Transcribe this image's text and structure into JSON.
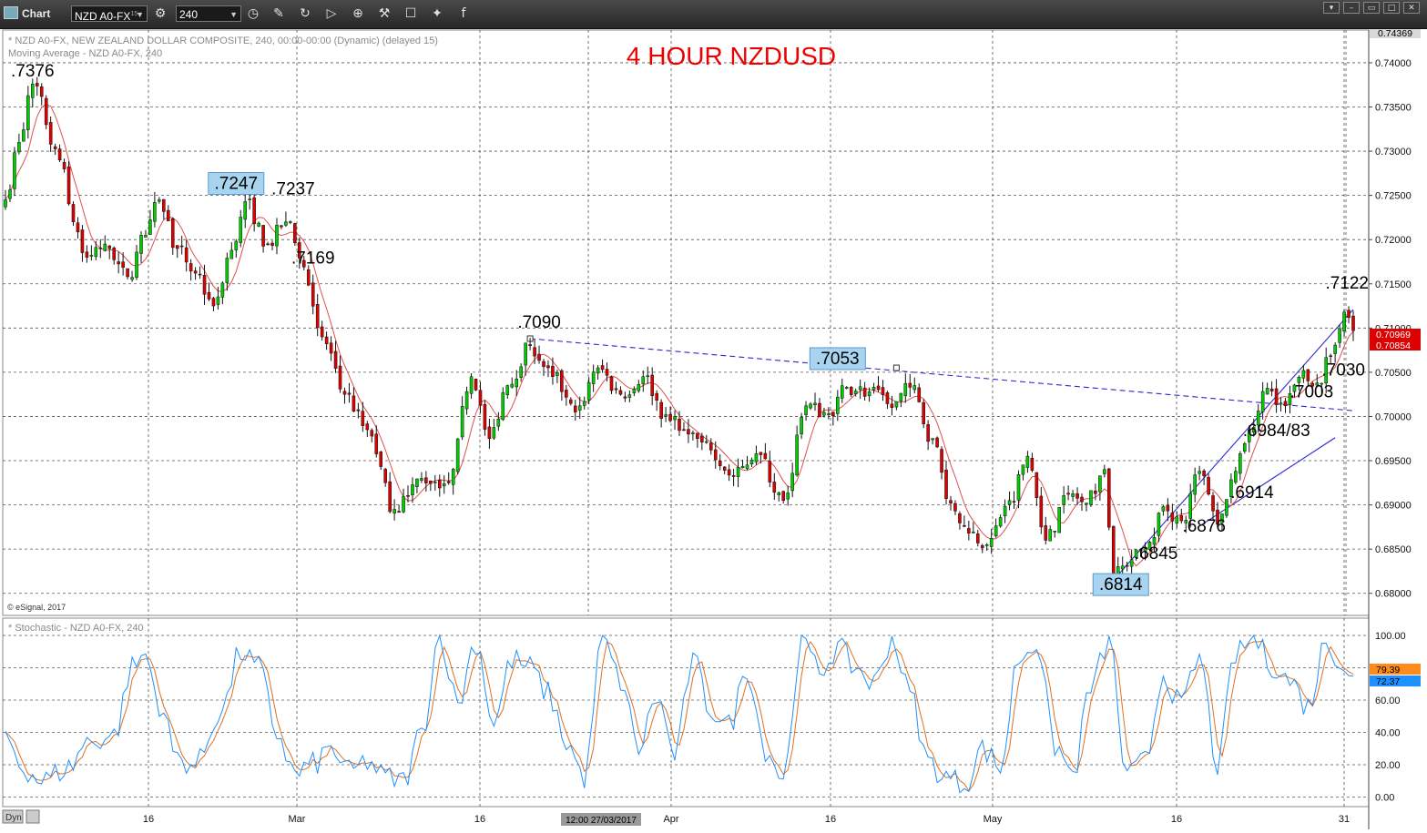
{
  "window": {
    "app_title": "Chart",
    "symbol": "NZD A0-FX",
    "symbol_sup": "15",
    "interval": "240",
    "icons": [
      "settings-icon",
      "interval-clock-icon",
      "draw-pencil-icon",
      "refresh-icon",
      "play-icon",
      "zoom-icon",
      "tools-icon",
      "comment-icon",
      "twitter-icon",
      "facebook-icon"
    ],
    "window_buttons": [
      "minimize",
      "restore",
      "maximize",
      "close"
    ]
  },
  "header": {
    "line1": "* NZD A0-FX, NEW ZEALAND DOLLAR COMPOSITE, 240, 00:00-00:00 (Dynamic) (delayed 15)",
    "line2": "Moving Average - NZD A0-FX, 240",
    "chart_title": "4 HOUR NZDUSD",
    "copyright": "© eSignal, 2017"
  },
  "colors": {
    "up": "#00cc00",
    "down": "#dd0000",
    "ma": "#e05050",
    "title": "#ee0000",
    "trend_dashed": "#2a2ad0",
    "trend_solid": "#2a2ad0",
    "stoch_k": "#1e90ff",
    "stoch_d": "#e07020",
    "price_tag": "#dd0000",
    "stoch_tag_k": "#1e90ff",
    "stoch_tag_d": "#ff8c1a",
    "highlight_box": "#a8d4f0"
  },
  "chart_data": {
    "type": "candlestick",
    "price_axis": {
      "ticks": [
        "0.74000",
        "0.73500",
        "0.73000",
        "0.72500",
        "0.72000",
        "0.71500",
        "0.71000",
        "0.70500",
        "0.70000",
        "0.69500",
        "0.69000",
        "0.68500",
        "0.68000"
      ],
      "ylim": [
        0.6775,
        0.7437
      ],
      "top_label": "0.74369",
      "current_tags": [
        "0.70969",
        "0.70854"
      ]
    },
    "x_axis": {
      "labels": [
        "16",
        "Mar",
        "16",
        "Apr",
        "16",
        "May",
        "16",
        "31"
      ],
      "cursor_label": "12:00 27/03/2017",
      "bar_count": 298
    },
    "annotations": [
      {
        "text": ".7376",
        "bar": 6,
        "price": 0.7376,
        "boxed": false
      },
      {
        "text": ".7247",
        "bar": 51,
        "price": 0.7247,
        "boxed": true
      },
      {
        "text": ".7237",
        "bar": 62,
        "price": 0.7237,
        "boxed": false
      },
      {
        "text": ".7169",
        "bar": 66,
        "price": 0.7169,
        "boxed": false
      },
      {
        "text": ".7090",
        "bar": 116,
        "price": 0.709,
        "boxed": false
      },
      {
        "text": ".7053",
        "bar": 184,
        "price": 0.7053,
        "boxed": true
      },
      {
        "text": ".6814",
        "bar": 245,
        "price": 0.6814,
        "boxed": true
      },
      {
        "text": ".6845",
        "bar": 250,
        "price": 0.6845,
        "boxed": false
      },
      {
        "text": ".6876",
        "bar": 261,
        "price": 0.6876,
        "boxed": false
      },
      {
        "text": ".6914",
        "bar": 272,
        "price": 0.6914,
        "boxed": false
      },
      {
        "text": ".6984/83",
        "bar": 277,
        "price": 0.6984,
        "boxed": false
      },
      {
        "text": ".7003",
        "bar": 286,
        "price": 0.7003,
        "boxed": false
      },
      {
        "text": ".7030",
        "bar": 291,
        "price": 0.703,
        "boxed": false
      },
      {
        "text": ".7122",
        "bar": 291,
        "price": 0.7122,
        "boxed": false
      }
    ],
    "trend_lines": [
      {
        "style": "dashed",
        "from": {
          "bar": 116,
          "price": 0.7088
        },
        "to": {
          "bar": 298,
          "price": 0.70065
        }
      },
      {
        "style": "solid",
        "from": {
          "bar": 245,
          "price": 0.6815
        },
        "to": {
          "bar": 298,
          "price": 0.7121
        }
      },
      {
        "style": "solid",
        "from": {
          "bar": 264,
          "price": 0.6876
        },
        "to": {
          "bar": 294,
          "price": 0.6976
        }
      }
    ],
    "price_anchors": [
      [
        0,
        0.7245
      ],
      [
        3,
        0.731
      ],
      [
        6,
        0.7376
      ],
      [
        12,
        0.729
      ],
      [
        15,
        0.722
      ],
      [
        18,
        0.718
      ],
      [
        22,
        0.7195
      ],
      [
        27,
        0.7158
      ],
      [
        31,
        0.7205
      ],
      [
        34,
        0.7245
      ],
      [
        38,
        0.719
      ],
      [
        42,
        0.7162
      ],
      [
        46,
        0.7125
      ],
      [
        50,
        0.7188
      ],
      [
        53,
        0.7243
      ],
      [
        58,
        0.7195
      ],
      [
        62,
        0.722
      ],
      [
        66,
        0.7169
      ],
      [
        70,
        0.709
      ],
      [
        75,
        0.7025
      ],
      [
        80,
        0.6985
      ],
      [
        86,
        0.6895
      ],
      [
        92,
        0.693
      ],
      [
        98,
        0.6925
      ],
      [
        103,
        0.7045
      ],
      [
        107,
        0.6975
      ],
      [
        111,
        0.7035
      ],
      [
        116,
        0.708
      ],
      [
        121,
        0.7045
      ],
      [
        126,
        0.7005
      ],
      [
        131,
        0.7055
      ],
      [
        136,
        0.7025
      ],
      [
        141,
        0.7045
      ],
      [
        146,
        0.7002
      ],
      [
        151,
        0.698
      ],
      [
        156,
        0.6962
      ],
      [
        161,
        0.6932
      ],
      [
        166,
        0.6958
      ],
      [
        172,
        0.6905
      ],
      [
        177,
        0.7012
      ],
      [
        182,
        0.7003
      ],
      [
        186,
        0.7033
      ],
      [
        191,
        0.7028
      ],
      [
        196,
        0.701
      ],
      [
        200,
        0.7033
      ],
      [
        205,
        0.6975
      ],
      [
        209,
        0.6902
      ],
      [
        213,
        0.6868
      ],
      [
        217,
        0.6855
      ],
      [
        222,
        0.6905
      ],
      [
        226,
        0.6955
      ],
      [
        230,
        0.686
      ],
      [
        235,
        0.6912
      ],
      [
        239,
        0.6902
      ],
      [
        243,
        0.694
      ],
      [
        245,
        0.682
      ],
      [
        249,
        0.6838
      ],
      [
        253,
        0.6858
      ],
      [
        256,
        0.6898
      ],
      [
        260,
        0.6882
      ],
      [
        264,
        0.6938
      ],
      [
        268,
        0.6878
      ],
      [
        272,
        0.6938
      ],
      [
        275,
        0.6985
      ],
      [
        279,
        0.7032
      ],
      [
        283,
        0.7012
      ],
      [
        287,
        0.7052
      ],
      [
        290,
        0.7038
      ],
      [
        293,
        0.7068
      ],
      [
        296,
        0.7118
      ],
      [
        298,
        0.7097
      ]
    ],
    "stochastic": {
      "label": "* Stochastic - NZD A0-FX, 240",
      "ticks": [
        "100.00",
        "80.00",
        "60.00",
        "40.00",
        "20.00",
        "0.00"
      ],
      "ylim": [
        0,
        100
      ],
      "k_last": "72.37",
      "d_last": "79.39",
      "k_anchors": [
        [
          0,
          38
        ],
        [
          4,
          18
        ],
        [
          8,
          10
        ],
        [
          14,
          18
        ],
        [
          18,
          34
        ],
        [
          24,
          38
        ],
        [
          28,
          80
        ],
        [
          31,
          88
        ],
        [
          34,
          58
        ],
        [
          38,
          24
        ],
        [
          42,
          20
        ],
        [
          48,
          55
        ],
        [
          52,
          90
        ],
        [
          56,
          80
        ],
        [
          60,
          40
        ],
        [
          64,
          14
        ],
        [
          68,
          20
        ],
        [
          72,
          30
        ],
        [
          76,
          15
        ],
        [
          80,
          22
        ],
        [
          84,
          12
        ],
        [
          88,
          10
        ],
        [
          92,
          40
        ],
        [
          96,
          100
        ],
        [
          100,
          58
        ],
        [
          104,
          96
        ],
        [
          108,
          46
        ],
        [
          112,
          85
        ],
        [
          116,
          80
        ],
        [
          120,
          64
        ],
        [
          124,
          34
        ],
        [
          128,
          12
        ],
        [
          132,
          98
        ],
        [
          136,
          72
        ],
        [
          140,
          30
        ],
        [
          144,
          62
        ],
        [
          148,
          26
        ],
        [
          152,
          84
        ],
        [
          156,
          54
        ],
        [
          160,
          44
        ],
        [
          164,
          80
        ],
        [
          168,
          30
        ],
        [
          172,
          12
        ],
        [
          176,
          96
        ],
        [
          180,
          78
        ],
        [
          184,
          92
        ],
        [
          188,
          80
        ],
        [
          192,
          70
        ],
        [
          196,
          98
        ],
        [
          200,
          64
        ],
        [
          204,
          22
        ],
        [
          208,
          12
        ],
        [
          212,
          8
        ],
        [
          216,
          30
        ],
        [
          220,
          18
        ],
        [
          224,
          86
        ],
        [
          228,
          96
        ],
        [
          232,
          32
        ],
        [
          236,
          14
        ],
        [
          240,
          68
        ],
        [
          244,
          96
        ],
        [
          248,
          12
        ],
        [
          252,
          22
        ],
        [
          256,
          76
        ],
        [
          260,
          56
        ],
        [
          264,
          86
        ],
        [
          268,
          20
        ],
        [
          272,
          88
        ],
        [
          276,
          98
        ],
        [
          280,
          82
        ],
        [
          284,
          72
        ],
        [
          288,
          56
        ],
        [
          292,
          96
        ],
        [
          296,
          82
        ],
        [
          298,
          72
        ]
      ]
    }
  }
}
